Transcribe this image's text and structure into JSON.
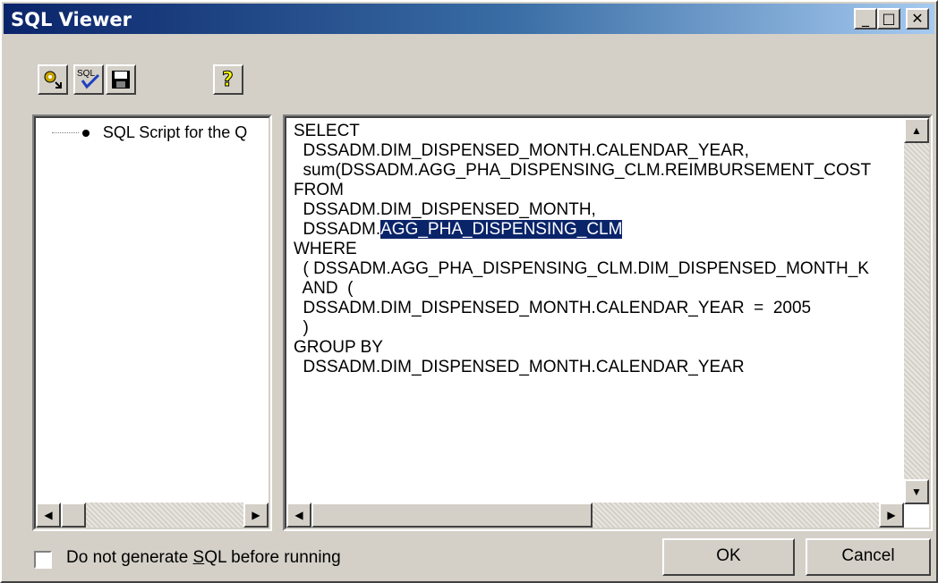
{
  "window": {
    "title": "SQL Viewer"
  },
  "titlebar": {
    "minimize": "_",
    "maximize": "□",
    "close": "✕"
  },
  "toolbar": {
    "buttons": [
      {
        "icon": "run-query-icon"
      },
      {
        "icon": "sql-check-icon",
        "label": "SQL"
      },
      {
        "icon": "save-icon"
      },
      {
        "icon": "help-icon",
        "label": "?"
      }
    ]
  },
  "tree": {
    "item": "SQL Script for the Q"
  },
  "sql": {
    "lines_before": "SELECT\n  DSSADM.DIM_DISPENSED_MONTH.CALENDAR_YEAR,\n  sum(DSSADM.AGG_PHA_DISPENSING_CLM.REIMBURSEMENT_COST\nFROM\n  DSSADM.DIM_DISPENSED_MONTH,\n  DSSADM.",
    "selected": "AGG_PHA_DISPENSING_CLM",
    "lines_after": "\nWHERE\n  ( DSSADM.AGG_PHA_DISPENSING_CLM.DIM_DISPENSED_MONTH_K\n  AND  (\n  DSSADM.DIM_DISPENSED_MONTH.CALENDAR_YEAR  =  2005\n  )\nGROUP BY\n  DSSADM.DIM_DISPENSED_MONTH.CALENDAR_YEAR"
  },
  "footer": {
    "checkbox_label_pre": "Do not generate ",
    "checkbox_label_accel": "S",
    "checkbox_label_post": "QL before running",
    "ok_label": "OK",
    "cancel_label": "Cancel"
  }
}
